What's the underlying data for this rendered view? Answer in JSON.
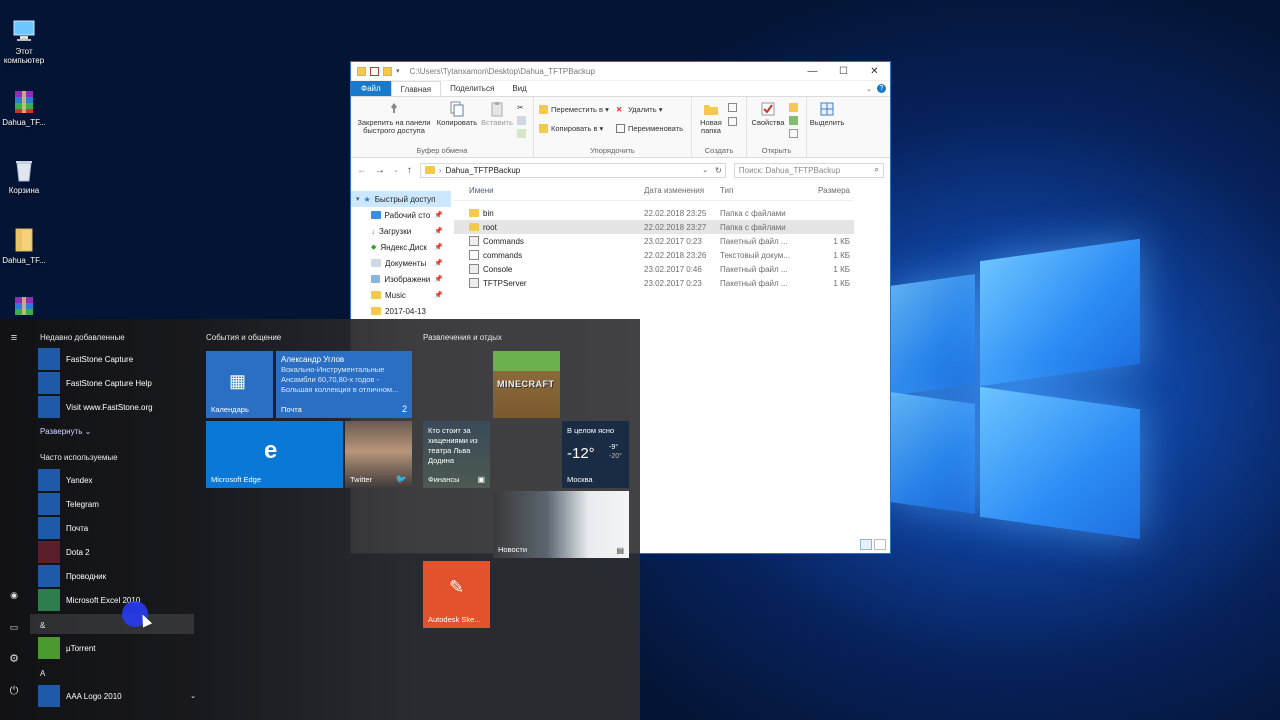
{
  "desktop": {
    "icons": [
      {
        "label": "Этот компьютер",
        "icon": "computer-icon"
      },
      {
        "label": "Dahua_TF...",
        "icon": "archive-icon"
      },
      {
        "label": "Корзина",
        "icon": "recycle-bin-icon"
      },
      {
        "label": "Dahua_TF...",
        "icon": "folder-icon"
      },
      {
        "label": "",
        "icon": "archive-icon"
      }
    ]
  },
  "explorer": {
    "title_path": "C:\\Users\\Tytanxamon\\Desktop\\Dahua_TFTPBackup",
    "window_buttons": {
      "minimize": "—",
      "maximize": "☐",
      "close": "✕"
    },
    "tabs": [
      "Файл",
      "Главная",
      "Поделиться",
      "Вид"
    ],
    "ribbon": {
      "pin": "Закрепить на панели быстрого доступа",
      "copy": "Копировать",
      "paste": "Вставить",
      "clipboard_group": "Буфер обмена",
      "move_to": "Переместить в ▾",
      "copy_to": "Копировать в ▾",
      "delete": "Удалить ▾",
      "rename": "Переименовать",
      "organize_group": "Упорядочить",
      "new_folder": "Новая папка",
      "create_group": "Создать",
      "properties": "Свойства",
      "open_group": "Открыть",
      "select": "Выделить"
    },
    "address": "Dahua_TFTPBackup",
    "search_placeholder": "Поиск: Dahua_TFTPBackup",
    "nav": [
      {
        "label": "Быстрый доступ",
        "pinned": false
      },
      {
        "label": "Рабочий сто",
        "pinned": true
      },
      {
        "label": "Загрузки",
        "pinned": true
      },
      {
        "label": "Яндекс.Диск",
        "pinned": true
      },
      {
        "label": "Документы",
        "pinned": true
      },
      {
        "label": "Изображени",
        "pinned": true
      },
      {
        "label": "Music",
        "pinned": true
      },
      {
        "label": "2017-04-13",
        "pinned": false
      }
    ],
    "columns": [
      "Имени",
      "Дата изменения",
      "Тип",
      "Размера"
    ],
    "files": [
      {
        "name": "bin",
        "date": "22.02.2018 23:25",
        "type": "Папка с файлами",
        "size": "",
        "kind": "folder"
      },
      {
        "name": "root",
        "date": "22.02.2018 23:27",
        "type": "Папка с файлами",
        "size": "",
        "kind": "folder"
      },
      {
        "name": "Commands",
        "date": "23.02.2017 0:23",
        "type": "Пакетный файл ...",
        "size": "1 КБ",
        "kind": "file"
      },
      {
        "name": "commands",
        "date": "22.02.2018 23:26",
        "type": "Текстовый докум...",
        "size": "1 КБ",
        "kind": "text"
      },
      {
        "name": "Console",
        "date": "23.02.2017 0:46",
        "type": "Пакетный файл ...",
        "size": "1 КБ",
        "kind": "file"
      },
      {
        "name": "TFTPServer",
        "date": "23.02.2017 0:23",
        "type": "Пакетный файл ...",
        "size": "1 КБ",
        "kind": "file"
      }
    ]
  },
  "start_menu": {
    "recently_added": "Недавно добавленные",
    "recent_apps": [
      "FastStone Capture",
      "FastStone Capture Help",
      "Visit www.FastStone.org"
    ],
    "expand": "Развернуть ⌄",
    "frequent": "Часто используемые",
    "frequent_apps": [
      "Yandex",
      "Telegram",
      "Почта",
      "Dota 2",
      "Проводник",
      "Microsoft Excel 2010"
    ],
    "letter_amp": "&",
    "utorrent": "µTorrent",
    "letter_a": "A",
    "aaa_logo": "AAA Logo 2010",
    "group1": "События и общение",
    "group2": "Развлечения и отдых",
    "tiles": {
      "calendar": "Календарь",
      "mail_sender": "Александр Углов",
      "mail_preview": "Вокально-Инструментальные Ансамбли 60,70,80-х годов - Большая коллекция в отличном...",
      "mail_label": "Почта",
      "mail_count": "2",
      "edge": "Microsoft Edge",
      "twitter": "Twitter",
      "minecraft": "MINECRAFT",
      "finance_text": "Кто стоит за хищениями из театра Льва Додина",
      "finance_label": "Финансы",
      "weather_cond": "В целом ясно",
      "weather_temp": "-12°",
      "weather_hi": "-9°",
      "weather_lo": "-20°",
      "weather_city": "Москва",
      "news": "Новости",
      "autodesk": "Autodesk Ske..."
    }
  }
}
